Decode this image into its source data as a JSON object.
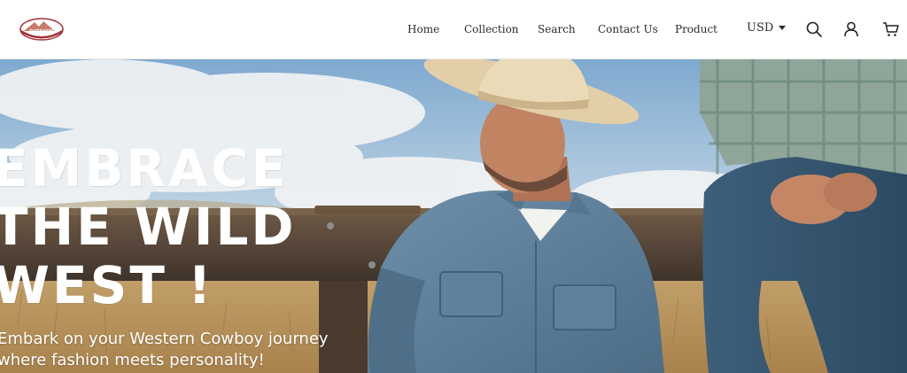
{
  "brand": {
    "logo_text": "DATAHUN"
  },
  "nav": {
    "items": [
      {
        "label": "Home"
      },
      {
        "label": "Collection"
      },
      {
        "label": "Search"
      },
      {
        "label": "Contact Us"
      },
      {
        "label": "Product"
      }
    ],
    "currency": "USD"
  },
  "header_icons": [
    "search-icon",
    "account-icon",
    "cart-icon"
  ],
  "hero": {
    "headline_lines": [
      "EMBRACE",
      "THE WILD",
      "WEST !"
    ],
    "subtitle_lines": [
      "Embark on your Western Cowboy journey",
      "where fashion meets personality!"
    ]
  },
  "colors": {
    "logo_red": "#a3323a",
    "sky": "#8fb6d8",
    "denim": "#5d7f99",
    "hat": "#e6d3ad"
  }
}
